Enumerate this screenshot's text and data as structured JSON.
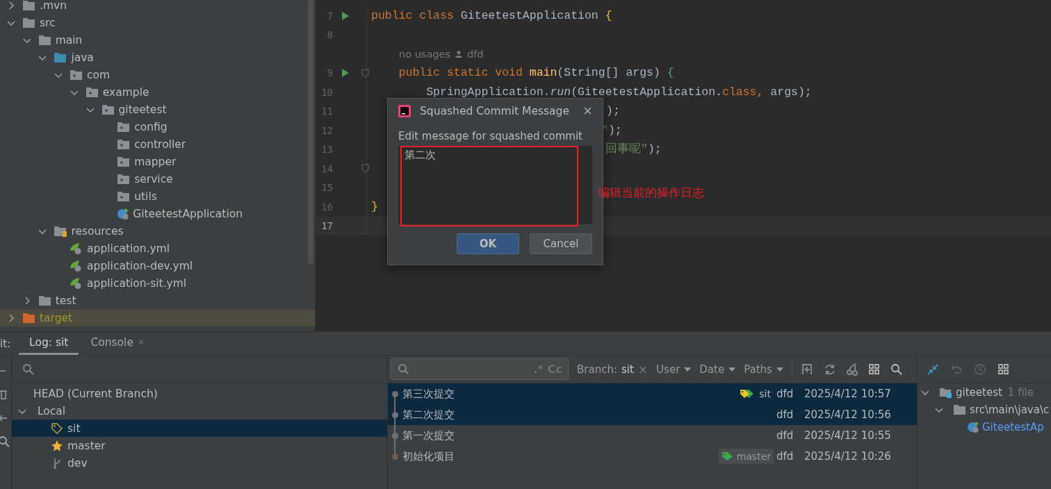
{
  "project_tree": [
    {
      "name": ".mvn",
      "kind": "folder",
      "expanded": false,
      "selected": false
    },
    {
      "name": "src",
      "kind": "folder",
      "expanded": true,
      "selected": false,
      "children": [
        {
          "name": "main",
          "kind": "folder",
          "expanded": true,
          "selected": false,
          "children": [
            {
              "name": "java",
              "kind": "source_folder",
              "expanded": true,
              "selected": false,
              "children": [
                {
                  "name": "com",
                  "kind": "package",
                  "expanded": true,
                  "selected": false,
                  "children": [
                    {
                      "name": "example",
                      "kind": "package",
                      "expanded": true,
                      "selected": false,
                      "children": [
                        {
                          "name": "giteetest",
                          "kind": "package",
                          "expanded": true,
                          "selected": false,
                          "children": [
                            {
                              "name": "config",
                              "kind": "package",
                              "selected": false
                            },
                            {
                              "name": "controller",
                              "kind": "package",
                              "selected": false
                            },
                            {
                              "name": "mapper",
                              "kind": "package",
                              "selected": false
                            },
                            {
                              "name": "service",
                              "kind": "package",
                              "selected": false
                            },
                            {
                              "name": "utils",
                              "kind": "package",
                              "selected": false
                            },
                            {
                              "name": "GiteetestApplication",
                              "kind": "spring_class",
                              "selected": false
                            }
                          ]
                        }
                      ]
                    }
                  ]
                }
              ]
            },
            {
              "name": "resources",
              "kind": "resources_folder",
              "expanded": true,
              "selected": false,
              "children": [
                {
                  "name": "application.yml",
                  "kind": "spring_yaml",
                  "selected": false
                },
                {
                  "name": "application-dev.yml",
                  "kind": "spring_yaml",
                  "selected": false
                },
                {
                  "name": "application-sit.yml",
                  "kind": "spring_yaml",
                  "selected": false
                }
              ]
            }
          ]
        },
        {
          "name": "test",
          "kind": "folder",
          "expanded": false,
          "selected": false
        }
      ]
    },
    {
      "name": "target",
      "kind": "excluded_folder",
      "expanded": false,
      "selected": true
    }
  ],
  "editor": {
    "lines": [
      {
        "kind": "code",
        "number": "7",
        "run": true,
        "current": false,
        "tokens": [
          {
            "t": "public class ",
            "kind": "keyword"
          },
          {
            "t": "GiteetestApplication",
            "kind": "plain"
          },
          {
            "t": " {",
            "kind": "brace1"
          }
        ]
      },
      {
        "kind": "code",
        "number": "8",
        "current": false
      },
      {
        "kind": "hint",
        "usages": "no usages",
        "author": "dfd"
      },
      {
        "kind": "code",
        "number": "9",
        "run": true,
        "fold": true,
        "current": false,
        "tokens": [
          {
            "t": "    public static void ",
            "kind": "keyword"
          },
          {
            "t": "main",
            "kind": "method"
          },
          {
            "t": "(String[] args) ",
            "kind": "plain"
          },
          {
            "t": "{",
            "kind": "brace2"
          }
        ]
      },
      {
        "kind": "code",
        "number": "10",
        "current": false,
        "tokens": [
          {
            "t": "        SpringApplication.",
            "kind": "plain"
          },
          {
            "t": "run",
            "kind": "italic"
          },
          {
            "t": "(GiteetestApplication.",
            "kind": "plain"
          },
          {
            "t": "class",
            "kind": "keyword"
          },
          {
            "t": ", ",
            "kind": "keyword"
          },
          {
            "t": "args);",
            "kind": "plain"
          }
        ]
      },
      {
        "kind": "code",
        "number": "11",
        "current": false,
        "tail": true,
        "tokens": [
          {
            "t": ");",
            "kind": "plain"
          }
        ]
      },
      {
        "kind": "code",
        "number": "12",
        "current": false,
        "tail": true,
        "tokens": [
          {
            "t": "\"",
            "kind": "string"
          },
          {
            "t": ");",
            "kind": "plain"
          }
        ]
      },
      {
        "kind": "code",
        "number": "13",
        "current": false,
        "tail": true,
        "tokens": [
          {
            "t": "回事呢\"",
            "kind": "string"
          },
          {
            "t": ");",
            "kind": "plain"
          }
        ]
      },
      {
        "kind": "code",
        "number": "14",
        "fold": true,
        "current": false
      },
      {
        "kind": "code",
        "number": "15",
        "current": false
      },
      {
        "kind": "code",
        "number": "16",
        "current": false,
        "tokens": [
          {
            "t": "}",
            "kind": "brace1"
          }
        ]
      },
      {
        "kind": "code",
        "number": "17",
        "current": true
      }
    ]
  },
  "dialog": {
    "title": "Squashed Commit Message",
    "close": "×",
    "label": "Edit message for squashed commit",
    "message": "第二次",
    "buttons": [
      {
        "label": "OK",
        "default": true
      },
      {
        "label": "Cancel",
        "default": false
      }
    ]
  },
  "annotation": {
    "text": "编辑当前的操作日志"
  },
  "bottom_panel": {
    "title": "it:",
    "tabs": [
      {
        "label": "Log: sit",
        "selected": true
      },
      {
        "label": "Console",
        "selected": false,
        "close": "×"
      }
    ],
    "branches": [
      {
        "name": "HEAD (Current Branch)",
        "kind": "head",
        "selected": false
      },
      {
        "name": "Local",
        "kind": "group",
        "expanded": true,
        "selected": false,
        "children": [
          {
            "name": "sit",
            "kind": "current",
            "selected": true
          },
          {
            "name": "master",
            "kind": "favorite",
            "selected": false
          },
          {
            "name": "dev",
            "kind": "branch",
            "selected": false
          }
        ]
      }
    ],
    "filters": {
      "regex": ".*",
      "case": "Cc",
      "branch": "Branch: sit",
      "branch_clear": "×",
      "menus": [
        "User",
        "Date",
        "Paths"
      ]
    },
    "commits": [
      {
        "message": "第三次提交",
        "color": "#6f6f78",
        "tags": [
          {
            "name": "sit",
            "kind": "head"
          }
        ],
        "author": "dfd",
        "date": "2025/4/12 10:57",
        "selected": true
      },
      {
        "message": "第二次提交",
        "color": "#6f6f78",
        "author": "dfd",
        "date": "2025/4/12 10:56",
        "selected": true
      },
      {
        "message": "第一次提交",
        "color": "#6f6f78",
        "author": "dfd",
        "date": "2025/4/12 10:55",
        "selected": false
      },
      {
        "message": "初始化项目",
        "color": "#6e5e52",
        "tags": [
          {
            "name": "master",
            "kind": "branch"
          }
        ],
        "author": "dfd",
        "date": "2025/4/12 10:26",
        "selected": false
      }
    ],
    "changes": [
      {
        "name": "giteetest",
        "kind": "module",
        "note": "1 file",
        "children": [
          {
            "name": "src\\main\\java\\c",
            "kind": "folder",
            "children": [
              {
                "name": "GiteetestAp",
                "kind": "spring_class"
              }
            ]
          }
        ]
      }
    ]
  }
}
